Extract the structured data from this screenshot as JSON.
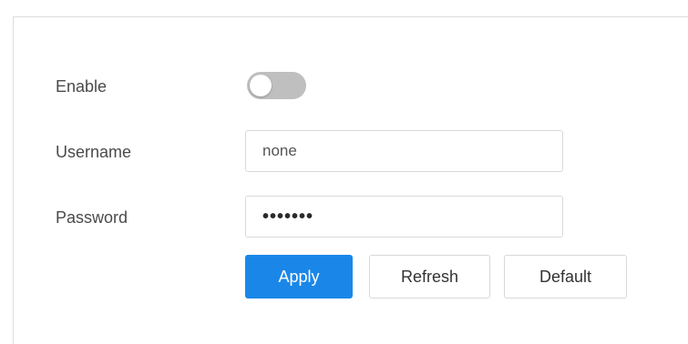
{
  "form": {
    "enable": {
      "label": "Enable",
      "value": false
    },
    "username": {
      "label": "Username",
      "value": "none"
    },
    "password": {
      "label": "Password",
      "value": "•••••••"
    }
  },
  "buttons": {
    "apply": "Apply",
    "refresh": "Refresh",
    "default": "Default"
  },
  "colors": {
    "primary": "#1a87e8",
    "toggle_off": "#bfbfbf",
    "border": "#d9d9d9",
    "label_text": "#4a4a4a"
  }
}
